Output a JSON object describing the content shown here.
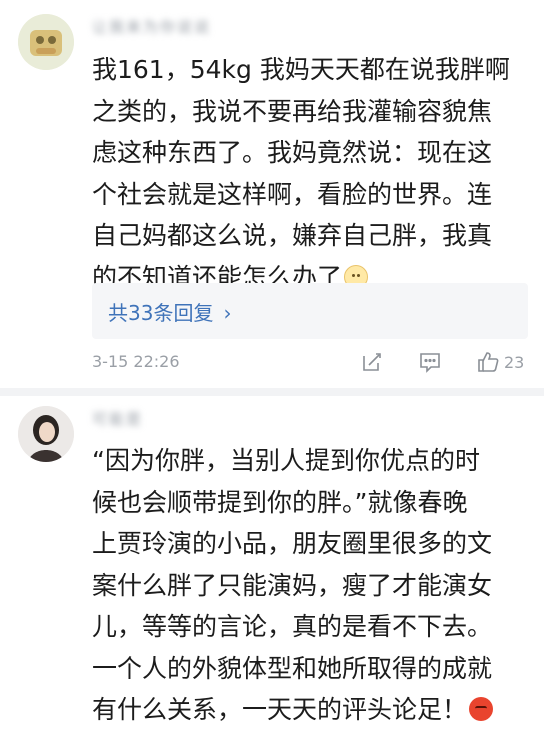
{
  "comments": [
    {
      "username": "让我来为你说说",
      "text_lines": [
        "我161，54kg 我妈天天都在说我胖啊",
        "之类的，我说不要再给我灌输容貌焦",
        "虑这种东西了。我妈竟然说：现在这",
        "个社会就是这样啊，看脸的世界。连",
        "自己妈都这么说，嫌弃自己胖，我真",
        "的不知道还能怎么办了"
      ],
      "emoji": "unhappy-face-emoji",
      "replies_label": "共33条回复",
      "timestamp": "3-15 22:26",
      "like_count": "23"
    },
    {
      "username": "可能是",
      "text_lines": [
        "“因为你胖，当别人提到你优点的时",
        "候也会顺带提到你的胖。”就像春晚",
        "上贾玲演的小品，朋友圈里很多的文",
        "案什么胖了只能演妈，瘦了才能演女",
        "儿，等等的言论，真的是看不下去。",
        "一个人的外貌体型和她所取得的成就",
        "有什么关系，一天天的评头论足！"
      ],
      "emoji": "angry-face-emoji"
    }
  ],
  "colors": {
    "link": "#3f73b9",
    "meta": "#9a9fa6",
    "reply_bg": "#f5f6f8"
  },
  "icons": [
    "edit-icon",
    "comment-icon",
    "like-thumb-icon"
  ]
}
